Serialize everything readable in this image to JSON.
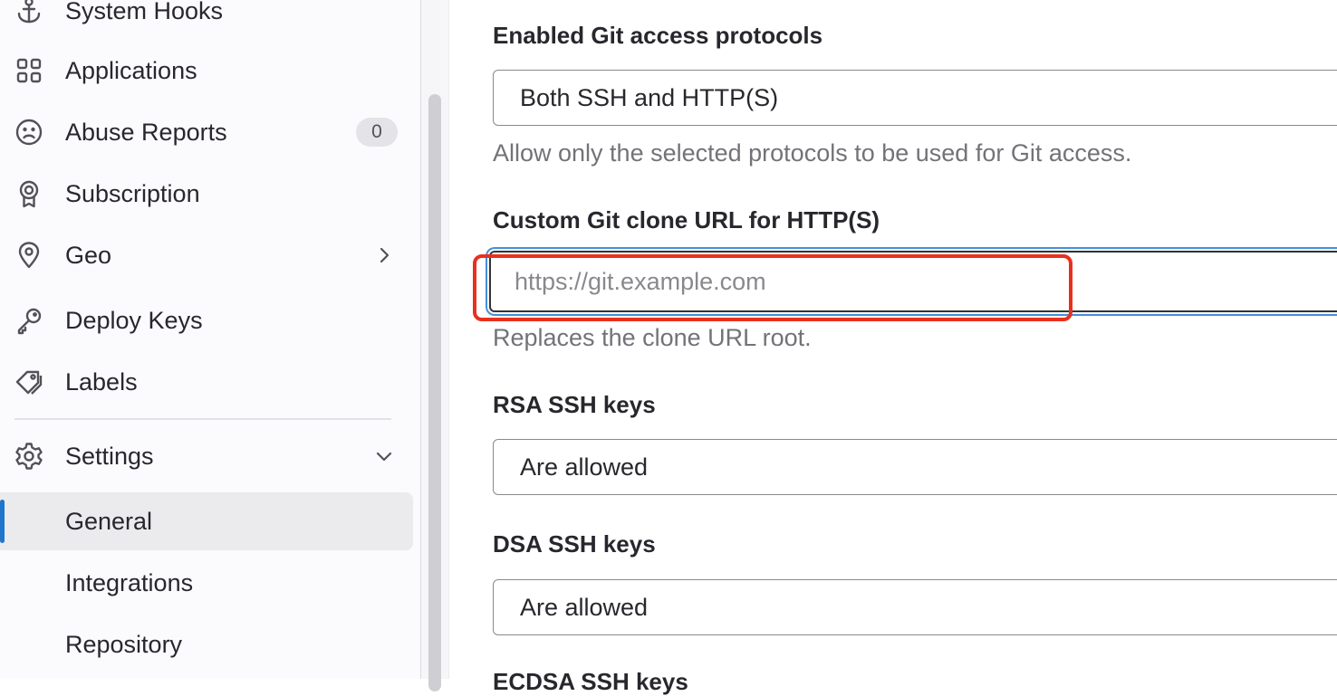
{
  "sidebar": {
    "items": [
      {
        "label": "System Hooks",
        "icon": "anchor-icon"
      },
      {
        "label": "Applications",
        "icon": "applications-grid-icon"
      },
      {
        "label": "Abuse Reports",
        "icon": "sad-face-icon",
        "badge": "0"
      },
      {
        "label": "Subscription",
        "icon": "license-icon"
      },
      {
        "label": "Geo",
        "icon": "location-pin-icon"
      },
      {
        "label": "Deploy Keys",
        "icon": "key-icon"
      },
      {
        "label": "Labels",
        "icon": "labels-icon"
      },
      {
        "label": "Settings",
        "icon": "gear-icon"
      },
      {
        "label": "General",
        "active": true
      },
      {
        "label": "Integrations"
      },
      {
        "label": "Repository"
      }
    ],
    "active_color": "#1f75cb"
  },
  "main": {
    "git_protocols": {
      "label": "Enabled Git access protocols",
      "value": "Both SSH and HTTP(S)",
      "help": "Allow only the selected protocols to be used for Git access."
    },
    "clone_url": {
      "label": "Custom Git clone URL for HTTP(S)",
      "placeholder": "https://git.example.com",
      "value": "",
      "help": "Replaces the clone URL root."
    },
    "rsa_keys": {
      "label": "RSA SSH keys",
      "value": "Are allowed"
    },
    "dsa_keys": {
      "label": "DSA SSH keys",
      "value": "Are allowed"
    },
    "ecdsa_keys": {
      "label": "ECDSA SSH keys"
    }
  },
  "colors": {
    "highlight": "#e8301f",
    "focus_ring": "#428fdc"
  }
}
